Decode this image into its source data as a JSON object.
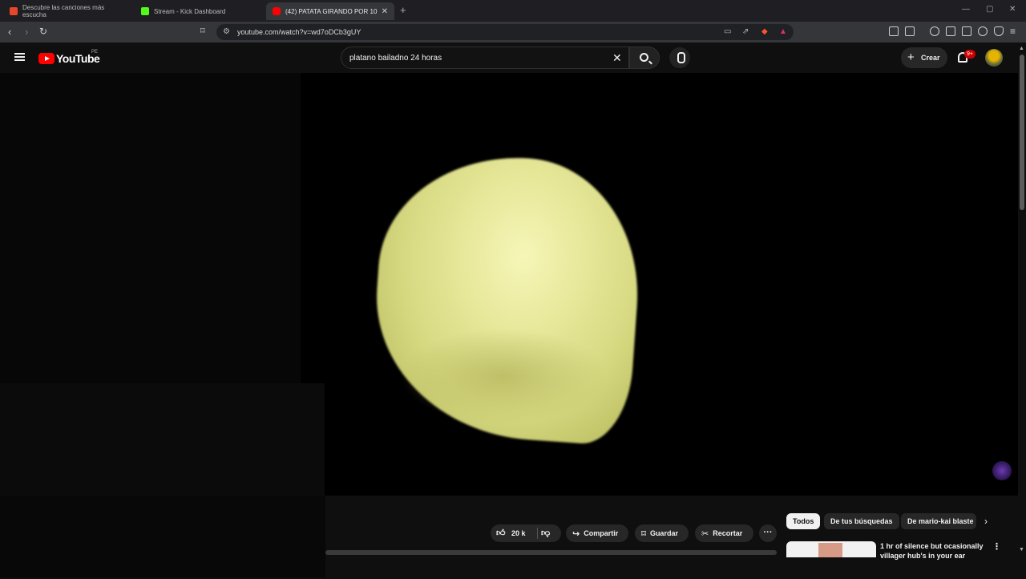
{
  "browser": {
    "tabs": [
      {
        "label": "Descubre las canciones más escucha",
        "favicon_color": "#e8462b"
      },
      {
        "label": "Stream - Kick Dashboard",
        "favicon_color": "#53fc18"
      },
      {
        "label": "(42) PATATA GIRANDO POR 10 H",
        "favicon_color": "#ff0000",
        "active": true
      }
    ],
    "new_tab": "+",
    "url": "youtube.com/watch?v=wd7oDCb3gUY"
  },
  "youtube": {
    "logo_text": "YouTube",
    "country": "PE",
    "search": {
      "value": "platano bailadno 24 horas"
    },
    "create_label": "Crear",
    "notifications_badge": "9+"
  },
  "actions": {
    "likes": "20 k",
    "share": "Compartir",
    "save": "Guardar",
    "clip": "Recortar"
  },
  "filters": [
    "Todos",
    "De tus búsquedas",
    "De mario-kai blaste"
  ],
  "recommendations": [
    {
      "title": "1 hr of silence but ocasionally villager hub's in your ear"
    }
  ]
}
